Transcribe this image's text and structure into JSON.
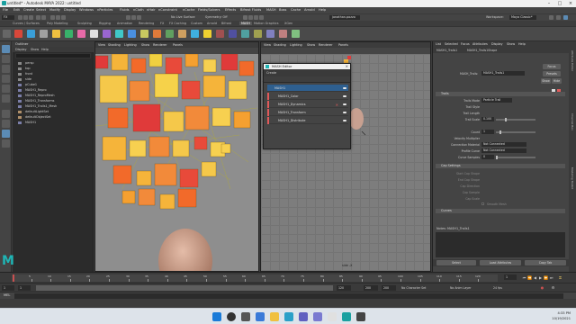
{
  "window": {
    "title": "untitled* - Autodesk MAYA 2022: untitled",
    "minimize": "–",
    "maximize": "□",
    "close": "×"
  },
  "menubar": [
    "File",
    "Edit",
    "Create",
    "Select",
    "Modify",
    "Display",
    "Windows",
    "nParticles",
    "Fluids",
    "nCloth",
    "nHair",
    "nConstraint",
    "nCache",
    "Fields/Solvers",
    "Effects",
    "Bifrost Fluids",
    "MASH",
    "Boss",
    "Cache",
    "Arnold",
    "Help"
  ],
  "statusline": {
    "mode": "FX",
    "live_surface": "No Live Surface",
    "symmetry": "Symmetry: Off",
    "user": "jonathan.pozzo",
    "workspace_label": "Workspace:",
    "workspace_value": "Maya Classic*"
  },
  "shelf_tabs": [
    "Curves / Surfaces",
    "Poly Modeling",
    "Sculpting",
    "Rigging",
    "Animation",
    "Rendering",
    "FX",
    "FX Caching",
    "Custom",
    "Arnold",
    "Bifrost",
    "MASH",
    "Motion Graphics",
    "XGen"
  ],
  "outliner": {
    "title": "Outliner",
    "menus": [
      "Display",
      "Show",
      "Help"
    ],
    "items": [
      {
        "label": "persp",
        "icon": "camera-icon"
      },
      {
        "label": "top",
        "icon": "camera-icon"
      },
      {
        "label": "front",
        "icon": "camera-icon"
      },
      {
        "label": "side",
        "icon": "camera-icon"
      },
      {
        "label": "pCube1",
        "icon": "mesh-icon"
      },
      {
        "label": "MASH1_Repro",
        "icon": "mesh-icon"
      },
      {
        "label": "MASH1_ReproMesh",
        "icon": "mesh-icon"
      },
      {
        "label": "MASH1_Transforms",
        "icon": "mesh-icon"
      },
      {
        "label": "MASH1_Trails1_Mesh",
        "icon": "mesh-icon"
      },
      {
        "label": "defaultLightSet",
        "icon": "set-icon"
      },
      {
        "label": "defaultObjectSet",
        "icon": "set-icon"
      },
      {
        "label": "MASH1",
        "icon": "mesh-icon"
      }
    ]
  },
  "viewport1": {
    "menus": [
      "View",
      "Shading",
      "Lighting",
      "Show",
      "Renderer",
      "Panels"
    ],
    "camera_label": "persp"
  },
  "viewport2": {
    "menus": [
      "View",
      "Shading",
      "Lighting",
      "Show",
      "Renderer",
      "Panels"
    ],
    "camera_label": "side -X"
  },
  "mash_editor": {
    "title": "MASH Editor",
    "create_label": "Create",
    "network": "MASH1",
    "nodes": [
      {
        "label": "MASH1_Color"
      },
      {
        "label": "MASH1_Dynamics"
      },
      {
        "label": "MASH1_Transform"
      },
      {
        "label": "MASH1_Distribute"
      }
    ]
  },
  "attribute_editor": {
    "tabs": [
      "List",
      "Selected",
      "Focus",
      "Attributes",
      "Display",
      "Show",
      "Help"
    ],
    "node_tabs": [
      "MASH1_Trails1",
      "MASH1_Trails1Shape"
    ],
    "node_label": "MASH_Trails:",
    "node_value": "MASH1_Trails1",
    "focus_btn": "Focus",
    "presets_btn": "Presets",
    "show_btn": "Show",
    "hide_btn": "Hide",
    "section_trails": "Trails",
    "fields": [
      {
        "label": "Trails Mode",
        "value": "Particle Trail"
      },
      {
        "label": "Trail Style",
        "value": ""
      },
      {
        "label": "Trail Length",
        "value": ""
      },
      {
        "label": "Trail Scale",
        "value": "0.100"
      },
      {
        "label": "Count",
        "value": "1"
      },
      {
        "label": "Velocity Multiplier",
        "value": ""
      },
      {
        "label": "Connection Material",
        "value": "Not Connected"
      },
      {
        "label": "Profile Curve",
        "value": "Not Connected"
      },
      {
        "label": "Curve Samples",
        "value": "0"
      }
    ],
    "section_cap": "Cap Settings",
    "cap_fields": [
      {
        "label": "Start Cap Shape",
        "value": ""
      },
      {
        "label": "End Cap Shape",
        "value": ""
      },
      {
        "label": "Cap Direction",
        "value": ""
      },
      {
        "label": "Cap Sample",
        "value": ""
      },
      {
        "label": "Cap Scale",
        "value": ""
      }
    ],
    "smooth_label": "Smooth Mesh",
    "section_curves": "Curves",
    "notes_label": "Notes: MASH1_Trails1",
    "buttons": [
      "Select",
      "Load Attributes",
      "Copy Tab"
    ]
  },
  "timeslider": {
    "ticks": [
      "5",
      "10",
      "15",
      "20",
      "25",
      "30",
      "35",
      "40",
      "45",
      "50",
      "55",
      "60",
      "65",
      "70",
      "75",
      "80",
      "85",
      "90",
      "95",
      "100",
      "105",
      "110",
      "115",
      "120"
    ],
    "current": "1"
  },
  "range": {
    "start": "1",
    "start_inner": "1",
    "end_inner": "120",
    "end": "200",
    "end2": "200",
    "char_set": "No Character Set",
    "anim_layer": "No Anim Layer",
    "fps": "24 fps"
  },
  "cmdline": {
    "lang": "MEL"
  },
  "taskbar": {
    "time": "4:33 PM",
    "date": "10/19/2021"
  }
}
